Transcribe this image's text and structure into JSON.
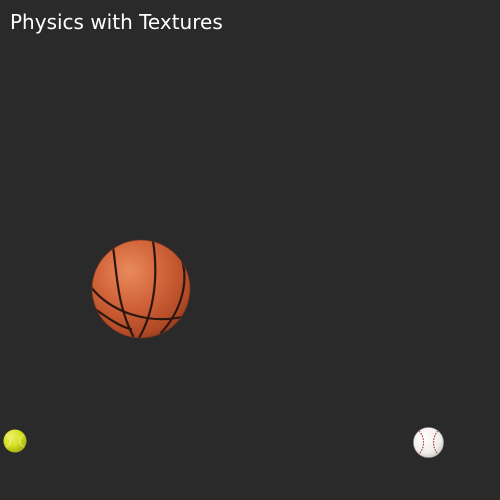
{
  "header": {
    "title": "Physics with Textures"
  },
  "scene": {
    "background_color": "#2a2a2a",
    "bodies": [
      {
        "name": "basketball",
        "texture": "basketball-texture",
        "color": "#d2643a"
      },
      {
        "name": "tennis-ball",
        "texture": "tennis-ball-texture",
        "color": "#d4e022"
      },
      {
        "name": "baseball",
        "texture": "baseball-texture",
        "color": "#f2f0ee",
        "stitch_color": "#b03040"
      }
    ]
  }
}
